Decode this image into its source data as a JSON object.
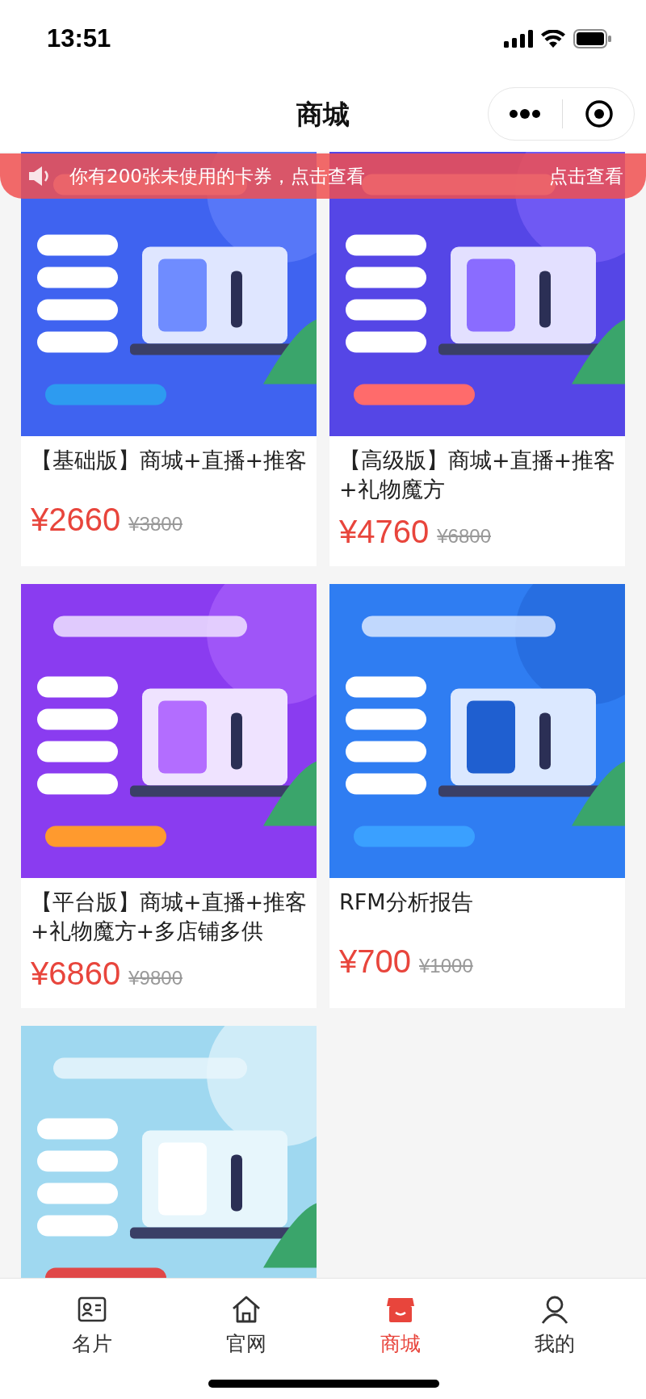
{
  "status_bar": {
    "time": "13:51"
  },
  "nav": {
    "title": "商城"
  },
  "notice": {
    "text": "你有200张未使用的卡券，点击查看",
    "action": "点击查看"
  },
  "products": [
    {
      "title": "【基础版】商城+直播+推客",
      "price": "¥2660",
      "original_price": "¥3800",
      "image": {
        "kind": "picture"
      }
    },
    {
      "title": "【高级版】商城+直播+推客+礼物魔方",
      "price": "¥4760",
      "original_price": "¥6800",
      "image": {
        "kind": "picture"
      }
    },
    {
      "title": "【平台版】商城+直播+推客+礼物魔方+多店铺多供",
      "price": "¥6860",
      "original_price": "¥9800",
      "image": {
        "kind": "picture"
      }
    },
    {
      "title": "RFM分析报告",
      "price": "¥700",
      "original_price": "¥1000",
      "image": {
        "kind": "picture"
      }
    },
    {
      "image": {
        "kind": "picture"
      }
    }
  ],
  "tab_bar": [
    {
      "label": "名片",
      "kind": "card",
      "selected": false
    },
    {
      "label": "官网",
      "kind": "home",
      "selected": false
    },
    {
      "label": "商城",
      "kind": "shop",
      "selected": true
    },
    {
      "label": "我的",
      "kind": "person",
      "selected": false
    }
  ]
}
